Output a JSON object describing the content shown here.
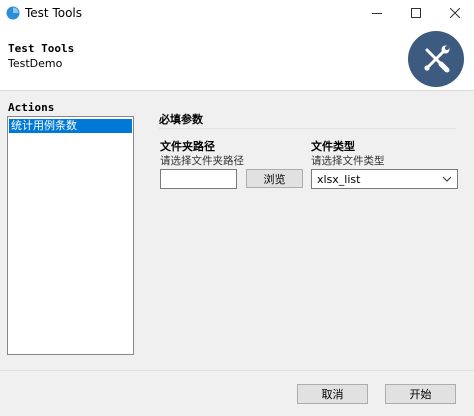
{
  "window": {
    "title": "Test Tools",
    "controls": {
      "minimize": "minimize-icon",
      "maximize": "maximize-icon",
      "close": "close-icon"
    }
  },
  "header": {
    "title": "Test Tools",
    "subtitle": "TestDemo",
    "badge_icon": "tools-icon",
    "badge_color": "#3d5a80"
  },
  "actions": {
    "label": "Actions",
    "items": [
      {
        "label": "统计用例条数",
        "selected": true
      }
    ],
    "selection_color": "#0078d7"
  },
  "params": {
    "section_title": "必填参数",
    "folder": {
      "label": "文件夹路径",
      "hint": "请选择文件夹路径",
      "value": "",
      "browse_label": "浏览"
    },
    "file_type": {
      "label": "文件类型",
      "hint": "请选择文件类型",
      "selected": "xlsx_list"
    }
  },
  "footer": {
    "cancel_label": "取消",
    "start_label": "开始"
  }
}
